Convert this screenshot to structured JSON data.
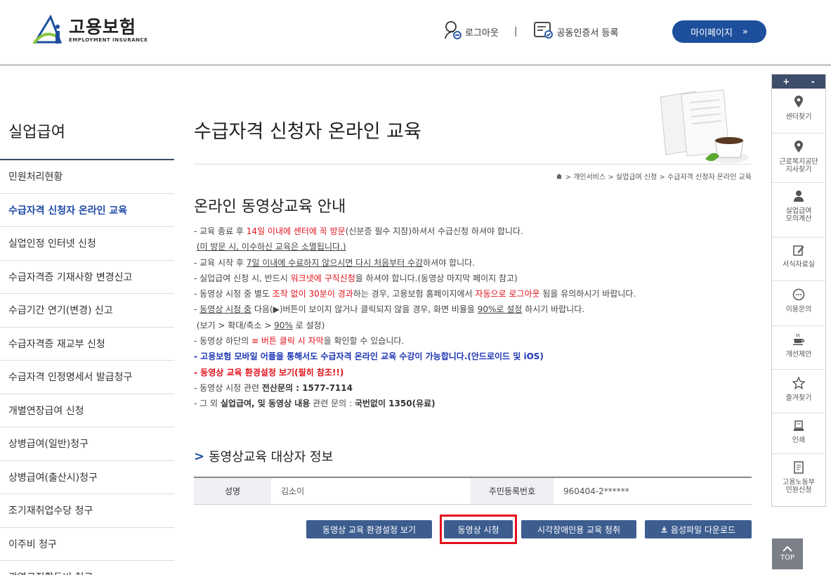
{
  "header": {
    "logo_title": "고용보험",
    "logo_sub": "EMPLOYMENT INSURANCE",
    "logout": "로그아웃",
    "separator": "|",
    "cert_register": "공동인증서 등록",
    "mypage": "마이페이지",
    "mypage_arrow": "»",
    "brand_color": "#1d4f9c"
  },
  "sidebar": {
    "title": "실업급여",
    "items": [
      {
        "label": "민원처리현황"
      },
      {
        "label": "수급자격 신청자 온라인 교육"
      },
      {
        "label": "실업인정 인터넷 신청"
      },
      {
        "label": "수급자격증 기재사항 변경신고"
      },
      {
        "label": "수급기간 연기(변경) 신고"
      },
      {
        "label": "수급자격증 재교부 신청"
      },
      {
        "label": "수급자격 인정명세서 발급청구"
      },
      {
        "label": "개별연장급여 신청"
      },
      {
        "label": "상병급여(일반)청구"
      },
      {
        "label": "상병급여(출산시)청구"
      },
      {
        "label": "조기재취업수당 청구"
      },
      {
        "label": "이주비 청구"
      },
      {
        "label": "광역구직활동비 청구"
      }
    ]
  },
  "main": {
    "page_title": "수급자격 신청자 온라인 교육",
    "breadcrumb": "> 개인서비스 > 실업급여 신청 > 수급자격 신청자 온라인 교육",
    "section_title": "온라인 동영상교육 안내",
    "guide": {
      "l1a": "- 교육 종료 후 ",
      "l1b": "14일 이내에 센터에 꼭 방문",
      "l1c": "(신분증 필수 지참)하셔서 수급신청 하셔야 합니다.",
      "l2": "(미 방문 시, 이수하신 교육은 소멸됩니다.)",
      "l3a": "- 교육 시작 후 ",
      "l3b": "7일 이내에 수료하지 않으시면 다시 처음부터 수강",
      "l3c": "하셔야 합니다.",
      "l4a": "- 실업급여 신청 시, 반드시 ",
      "l4b": "워크넷에 구직신청",
      "l4c": "을 하셔야 합니다.(동영상 마지막 페이지 참고)",
      "l5a": "- 동영상 시청 중 별도 ",
      "l5b": "조작 없이 30분이 경과",
      "l5c": "하는 경우, 고용보험 홈페이지에서 ",
      "l5d": "자동으로 로그아웃",
      "l5e": " 됨을 유의하시기 바랍니다.",
      "l6a": "- ",
      "l6b": "동영상 시청 중",
      "l6c": " 다음(▶)버튼이 보이지 않거나 클릭되지 않을 경우, 화면 비율을 ",
      "l6d": "90%로 설정",
      "l6e": " 하시기 바랍니다.",
      "l7a": "(보기 > 확대/축소 > ",
      "l7b": "90%",
      "l7c": " 로 설정)",
      "l8a": "- 동영상 하단의 ",
      "l8b": "≡ 버튼 클릭 시 자막",
      "l8c": "을 확인할 수 있습니다.",
      "l9": "- 고용보험 모바일 어플을 통해서도 수급자격 온라인 교육 수강이 가능합니다.(안드로이드 및 iOS)",
      "l10": "- 동영상 교육 환경설정 보기(필히 참조!!)",
      "l11a": "- 동영상 시청 관련 ",
      "l11b": "전산문의 : 1577-7114",
      "l12a": "- 그 외 ",
      "l12b": "실업급여, 및 동영상 내용",
      "l12c": " 관련 문의 : ",
      "l12d": "국번없이 1350(유료)"
    },
    "sub_title_chevron": ">",
    "sub_title": "동영상교육 대상자 정보",
    "table": {
      "name_label": "성명",
      "name_value": "김소이",
      "rrn_label": "주민등록번호",
      "rrn_value": "960404-2******"
    },
    "buttons": {
      "env": "동영상 교육 환경설정 보기",
      "watch": "동영상 시청",
      "visual": "시각장애인용 교육 청취",
      "download": "음성파일 다운로드"
    }
  },
  "quick": {
    "plus": "+",
    "minus": "-",
    "items": [
      {
        "label": "센터찾기"
      },
      {
        "label": "근로복지공단 지사찾기"
      },
      {
        "label": "실업급여 모의계산"
      },
      {
        "label": "서식자료실"
      },
      {
        "label": "이용문의"
      },
      {
        "label": "개선제안"
      },
      {
        "label": "즐겨찾기"
      },
      {
        "label": "인쇄"
      },
      {
        "label": "고용노동부 민원신청"
      }
    ],
    "top": "TOP"
  }
}
